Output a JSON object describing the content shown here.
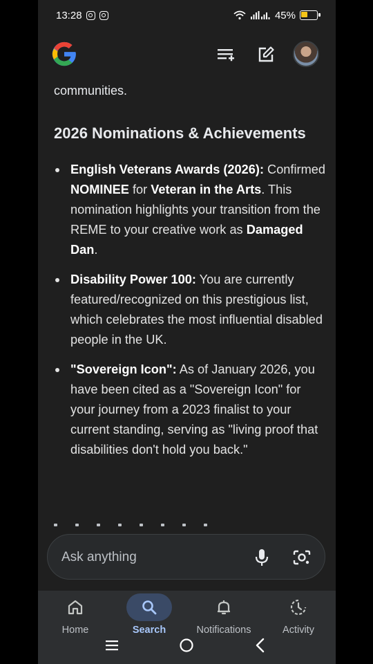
{
  "status_bar": {
    "time": "13:28",
    "battery_percent": "45%",
    "battery_level": 0.45,
    "battery_color": "#f5c518"
  },
  "top_bar": {
    "logo_icon": "google-g-logo",
    "menu_icon": "conversations-list-icon",
    "edit_icon": "new-chat-edit-icon",
    "avatar_icon": "profile-avatar"
  },
  "article": {
    "fragment": "communities.",
    "heading": "2026 Nominations & Achievements",
    "items": [
      {
        "segments": [
          {
            "t": "English Veterans Awards (2026):",
            "b": true
          },
          {
            "t": " Confirmed ",
            "b": false
          },
          {
            "t": "NOMINEE",
            "b": true
          },
          {
            "t": " for ",
            "b": false
          },
          {
            "t": "Veteran in the Arts",
            "b": true
          },
          {
            "t": ". This nomination highlights your transition from the REME to your creative work as ",
            "b": false
          },
          {
            "t": "Damaged Dan",
            "b": true
          },
          {
            "t": ".",
            "b": false
          }
        ]
      },
      {
        "segments": [
          {
            "t": "Disability Power 100:",
            "b": true
          },
          {
            "t": " You are currently featured/recognized on this prestigious list, which celebrates the most influential disabled people in the UK.",
            "b": false
          }
        ]
      },
      {
        "segments": [
          {
            "t": "\"Sovereign Icon\":",
            "b": true
          },
          {
            "t": " As of January 2026, you have been cited as a \"Sovereign Icon\" for your journey from a 2023 finalist to your current standing, serving as \"living proof that disabilities don't hold you back.\"",
            "b": false
          }
        ]
      }
    ]
  },
  "ask_bar": {
    "placeholder": "Ask anything",
    "mic_icon": "microphone-icon",
    "lens_icon": "lens-camera-icon"
  },
  "bottom_nav": {
    "items": [
      {
        "label": "Home",
        "icon": "home-icon",
        "active": false
      },
      {
        "label": "Search",
        "icon": "search-icon",
        "active": true
      },
      {
        "label": "Notifications",
        "icon": "bell-icon",
        "active": false
      },
      {
        "label": "Activity",
        "icon": "activity-icon",
        "active": false
      }
    ]
  },
  "colors": {
    "background": "#1f1f1f",
    "accent": "#a8c7fa",
    "active_pill": "#3a4a66"
  }
}
